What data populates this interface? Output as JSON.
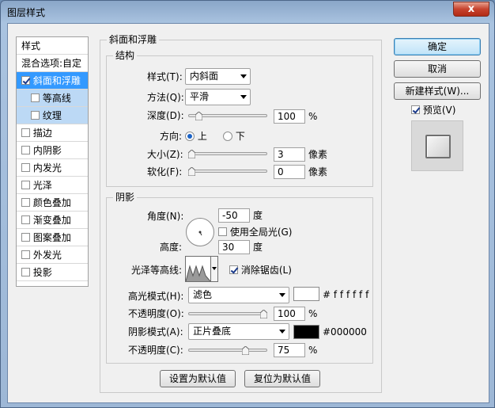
{
  "window": {
    "title": "图层样式",
    "close_glyph": "x"
  },
  "styles_list": {
    "items": [
      {
        "label": "样式",
        "checkbox": false,
        "checked": false
      },
      {
        "label": "混合选项:自定",
        "checkbox": false,
        "checked": false
      },
      {
        "label": "斜面和浮雕",
        "checkbox": true,
        "checked": true,
        "selected": true
      },
      {
        "label": "等高线",
        "checkbox": true,
        "checked": false,
        "sub": true
      },
      {
        "label": "纹理",
        "checkbox": true,
        "checked": false,
        "sub": true
      },
      {
        "label": "描边",
        "checkbox": true,
        "checked": false
      },
      {
        "label": "内阴影",
        "checkbox": true,
        "checked": false
      },
      {
        "label": "内发光",
        "checkbox": true,
        "checked": false
      },
      {
        "label": "光泽",
        "checkbox": true,
        "checked": false
      },
      {
        "label": "颜色叠加",
        "checkbox": true,
        "checked": false
      },
      {
        "label": "渐变叠加",
        "checkbox": true,
        "checked": false
      },
      {
        "label": "图案叠加",
        "checkbox": true,
        "checked": false
      },
      {
        "label": "外发光",
        "checkbox": true,
        "checked": false
      },
      {
        "label": "投影",
        "checkbox": true,
        "checked": false
      }
    ]
  },
  "bevel": {
    "title": "斜面和浮雕",
    "structure": {
      "title": "结构",
      "style_label": "样式(T):",
      "style_value": "内斜面",
      "technique_label": "方法(Q):",
      "technique_value": "平滑",
      "depth_label": "深度(D):",
      "depth_value": "100",
      "depth_unit": "%",
      "depth_level": 0.1,
      "direction_label": "方向:",
      "direction_up": "上",
      "direction_down": "下",
      "direction_selected": "上",
      "size_label": "大小(Z):",
      "size_value": "3",
      "size_unit": "像素",
      "size_level": 0.0,
      "soften_label": "软化(F):",
      "soften_value": "0",
      "soften_unit": "像素",
      "soften_level": 0.0
    },
    "shading": {
      "title": "阴影",
      "angle_label": "角度(N):",
      "angle_value": "-50",
      "angle_unit": "度",
      "global_light_label": "使用全局光(G)",
      "global_light_checked": false,
      "altitude_label": "高度:",
      "altitude_value": "30",
      "altitude_unit": "度",
      "gloss_label": "光泽等高线:",
      "antialias_label": "消除锯齿(L)",
      "antialias_checked": true,
      "highlight_mode_label": "高光模式(H):",
      "highlight_mode_value": "滤色",
      "highlight_color": "#ffffff",
      "highlight_color_text": "# f f f f f f",
      "highlight_opacity_label": "不透明度(O):",
      "highlight_opacity_value": "100",
      "highlight_opacity_unit": "%",
      "highlight_opacity_level": 1.0,
      "shadow_mode_label": "阴影模式(A):",
      "shadow_mode_value": "正片叠底",
      "shadow_color": "#000000",
      "shadow_color_text": "#000000",
      "shadow_opacity_label": "不透明度(C):",
      "shadow_opacity_value": "75",
      "shadow_opacity_unit": "%",
      "shadow_opacity_level": 0.75
    },
    "make_default": "设置为默认值",
    "reset_default": "复位为默认值"
  },
  "actions": {
    "ok": "确定",
    "cancel": "取消",
    "new_style": "新建样式(W)...",
    "preview_label": "预览(V)",
    "preview_checked": true
  }
}
